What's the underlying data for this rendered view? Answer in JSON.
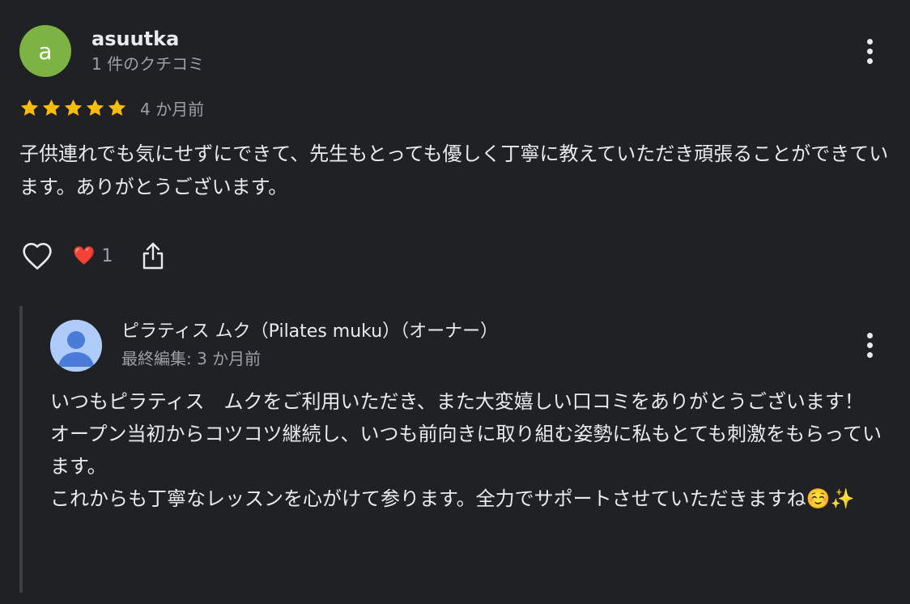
{
  "review": {
    "avatar_letter": "a",
    "avatar_color": "#7cb342",
    "reviewer_name": "asuutka",
    "reviewer_count": "1 件のクチコミ",
    "rating": 5,
    "rating_max": 5,
    "star_color": "#fbbc04",
    "time": "4 か月前",
    "text": "子供連れでも気にせずにできて、先生もとっても優しく丁寧に教えていただき頑張ることができています。ありがとうございます。",
    "more_icon": "more-vertical-icon"
  },
  "actions": {
    "like_icon": "heart-outline-icon",
    "reaction_emoji": "❤️",
    "reaction_count": "1",
    "share_icon": "share-icon"
  },
  "owner_reply": {
    "avatar_icon": "default-person-avatar-icon",
    "name": "ピラティス ムク（Pilates muku）（オーナー）",
    "edited": "最終編集: 3 か月前",
    "more_icon": "more-vertical-icon",
    "paragraphs": [
      "いつもピラティス　ムクをご利用いただき、また大変嬉しい口コミをありがとうございます！",
      "オープン当初からコツコツ継続し、いつも前向きに取り組む姿勢に私もとても刺激をもらっています。",
      "これからも丁寧なレッスンを心がけて参ります。全力でサポートさせていただきますね☺️✨"
    ]
  }
}
